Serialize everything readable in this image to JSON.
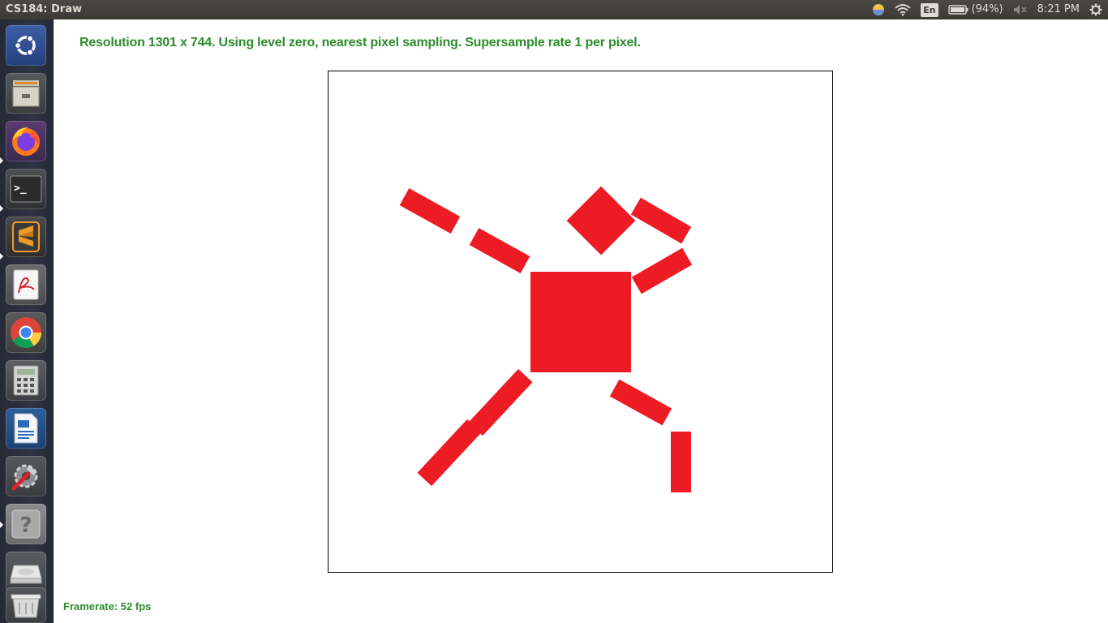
{
  "window": {
    "title": "CS184: Draw"
  },
  "tray": {
    "language": "En",
    "battery": "(94%)",
    "clock": "8:21 PM",
    "icons": [
      "night-light-icon",
      "wifi-icon",
      "battery-icon",
      "volume-muted-icon",
      "settings-gear-icon"
    ]
  },
  "launcher": {
    "items": [
      {
        "name": "ubuntu-dash",
        "icon": "ubuntu-logo-icon"
      },
      {
        "name": "files",
        "icon": "file-cabinet-icon"
      },
      {
        "name": "firefox",
        "icon": "firefox-icon"
      },
      {
        "name": "terminal",
        "icon": "terminal-icon"
      },
      {
        "name": "sublime-text",
        "icon": "sublime-icon"
      },
      {
        "name": "document-viewer",
        "icon": "pdf-viewer-icon"
      },
      {
        "name": "chrome",
        "icon": "chrome-icon"
      },
      {
        "name": "calculator",
        "icon": "calculator-icon"
      },
      {
        "name": "libreoffice-writer",
        "icon": "writer-icon"
      },
      {
        "name": "system-settings",
        "icon": "settings-tools-icon"
      },
      {
        "name": "help",
        "icon": "help-icon"
      },
      {
        "name": "drive",
        "icon": "drive-icon"
      },
      {
        "name": "trash",
        "icon": "trash-icon"
      }
    ]
  },
  "app": {
    "status": "Resolution 1301 x 744. Using level zero, nearest pixel sampling. Supersample rate 1 per pixel.",
    "framerate": "Framerate: 52 fps",
    "figure_color": "#ed1c24"
  }
}
